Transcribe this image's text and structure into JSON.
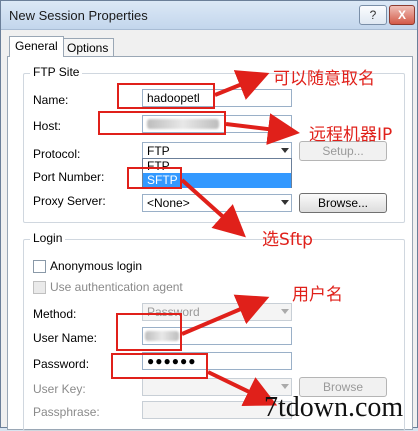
{
  "window": {
    "title": "New Session Properties",
    "help": "?",
    "close": "X"
  },
  "tabs": [
    {
      "label": "General"
    },
    {
      "label": "Options"
    }
  ],
  "ftp_site": {
    "legend": "FTP Site",
    "name_label": "Name:",
    "name_value": "hadoopetl",
    "host_label": "Host:",
    "protocol_label": "Protocol:",
    "protocol_value": "FTP",
    "protocol_options": [
      "FTP",
      "SFTP"
    ],
    "setup_button": "Setup...",
    "port_label": "Port Number:",
    "proxy_label": "Proxy Server:",
    "proxy_value": "<None>",
    "browse_button": "Browse..."
  },
  "login": {
    "legend": "Login",
    "anonymous": "Anonymous login",
    "use_agent": "Use authentication agent",
    "method_label": "Method:",
    "method_value": "Password",
    "username_label": "User Name:",
    "password_label": "Password:",
    "password_value": "●●●●●●",
    "userkey_label": "User Key:",
    "browse_button": "Browse",
    "passphrase_label": "Passphrase:"
  },
  "annotations": {
    "name_note": "可以随意取名",
    "host_note": "远程机器IP",
    "protocol_note": "选Sftp",
    "username_note": "用户名",
    "watermark": "7tdown.com"
  },
  "colors": {
    "annotation": "#e0201a",
    "selection": "#3399ff"
  }
}
